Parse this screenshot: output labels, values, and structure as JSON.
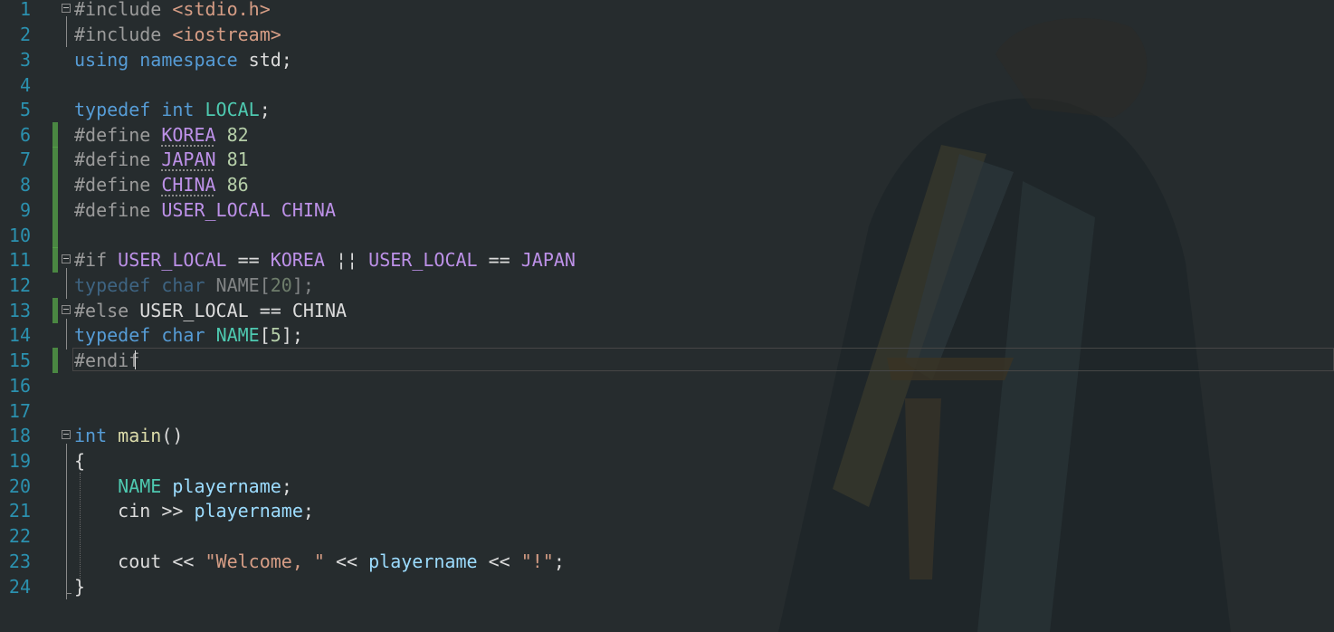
{
  "colors": {
    "background": "#262c2e",
    "line_number": "#2b91af",
    "keyword": "#569cd6",
    "string": "#d69d85",
    "number": "#b5cea8",
    "type": "#4ec9b0",
    "macro": "#bd91e8",
    "variable": "#9cdcfe",
    "function": "#dcdcaa",
    "changed_marker": "#57a64a"
  },
  "editor": {
    "cursor_line": 15,
    "lines": [
      {
        "n": "1",
        "t": [
          "#include ",
          "<stdio.h>"
        ]
      },
      {
        "n": "2",
        "t": [
          "#include ",
          "<iostream>"
        ]
      },
      {
        "n": "3",
        "t": [
          "using",
          " ",
          "namespace",
          " std;"
        ]
      },
      {
        "n": "4",
        "t": []
      },
      {
        "n": "5",
        "t": [
          "typedef",
          " ",
          "int",
          " ",
          "LOCAL",
          ";"
        ]
      },
      {
        "n": "6",
        "t": [
          "#define ",
          "KOREA",
          " ",
          "82"
        ]
      },
      {
        "n": "7",
        "t": [
          "#define ",
          "JAPAN",
          " ",
          "81"
        ]
      },
      {
        "n": "8",
        "t": [
          "#define ",
          "CHINA",
          " ",
          "86"
        ]
      },
      {
        "n": "9",
        "t": [
          "#define ",
          "USER_LOCAL",
          " ",
          "CHINA"
        ]
      },
      {
        "n": "10",
        "t": []
      },
      {
        "n": "11",
        "t": [
          "#if ",
          "USER_LOCAL",
          " == ",
          "KOREA",
          " ¦¦ ",
          "USER_LOCAL",
          " == ",
          "JAPAN"
        ]
      },
      {
        "n": "12",
        "t": [
          "typedef",
          " ",
          "char",
          " NAME[",
          "20",
          "];"
        ]
      },
      {
        "n": "13",
        "t": [
          "#else ",
          "USER_LOCAL == CHINA"
        ]
      },
      {
        "n": "14",
        "t": [
          "typedef",
          " ",
          "char",
          " ",
          "NAME",
          "[",
          "5",
          "];"
        ]
      },
      {
        "n": "15",
        "t": [
          "#endif"
        ]
      },
      {
        "n": "16",
        "t": []
      },
      {
        "n": "17",
        "t": []
      },
      {
        "n": "18",
        "t": [
          "int",
          " ",
          "main",
          "()"
        ]
      },
      {
        "n": "19",
        "t": [
          "{"
        ]
      },
      {
        "n": "20",
        "t": [
          "    ",
          "NAME",
          " ",
          "playername",
          ";"
        ]
      },
      {
        "n": "21",
        "t": [
          "    cin >> ",
          "playername",
          ";"
        ]
      },
      {
        "n": "22",
        "t": []
      },
      {
        "n": "23",
        "t": [
          "    cout << ",
          "\"Welcome, \"",
          " << ",
          "playername",
          " << ",
          "\"!\"",
          ";"
        ]
      },
      {
        "n": "24",
        "t": [
          "}"
        ]
      }
    ]
  }
}
